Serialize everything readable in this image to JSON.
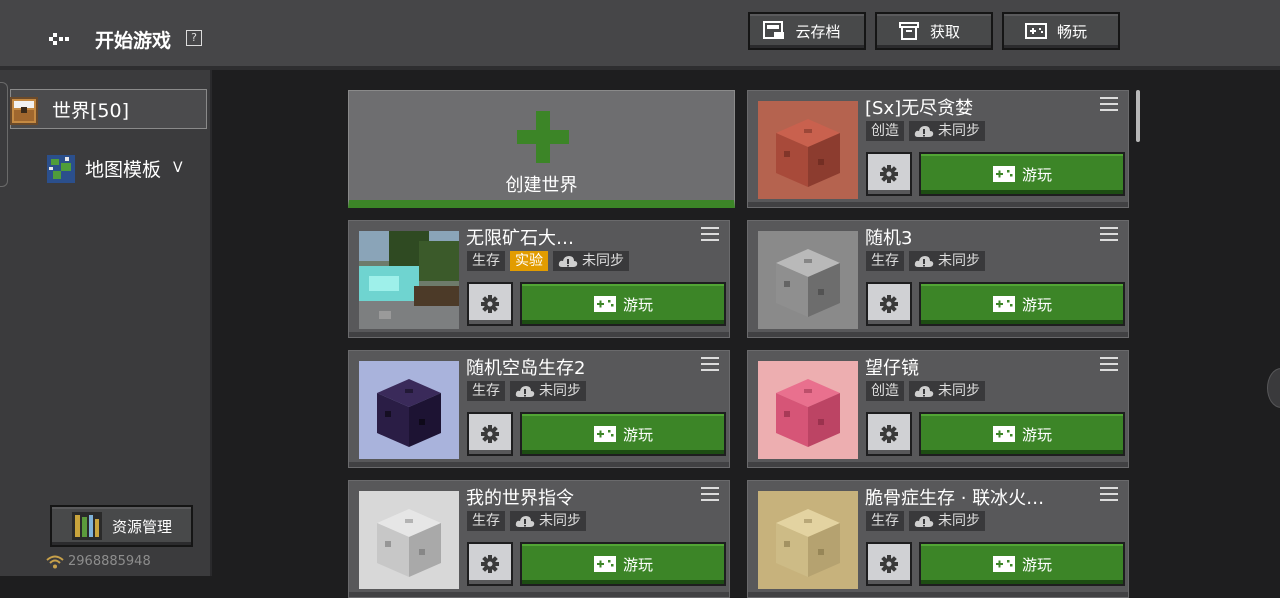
{
  "header": {
    "title": "开始游戏",
    "help_glyph": "?",
    "buttons": [
      {
        "label": "云存档",
        "icon": "cloud-save-icon"
      },
      {
        "label": "获取",
        "icon": "box-icon"
      },
      {
        "label": "畅玩",
        "icon": "gamepad-icon"
      }
    ]
  },
  "sidebar": {
    "items": [
      {
        "label": "世界[50]",
        "icon": "world-chest-icon",
        "selected": true
      },
      {
        "label": "地图模板",
        "icon": "map-globe-icon",
        "chevron": "ᐯ"
      }
    ],
    "resource_button": "资源管理",
    "connection_id": "2968885948"
  },
  "create_card": {
    "label": "创建世界"
  },
  "worlds": [
    {
      "name": "[Sx]无尽贪婪",
      "mode": "创造",
      "experimental": null,
      "sync": "未同步",
      "play": "游玩",
      "thumb": "red-block"
    },
    {
      "name": "无限矿石大…",
      "mode": "生存",
      "experimental": "实验",
      "sync": "未同步",
      "play": "游玩",
      "thumb": "landscape"
    },
    {
      "name": "随机3",
      "mode": "生存",
      "experimental": null,
      "sync": "未同步",
      "play": "游玩",
      "thumb": "gray-block"
    },
    {
      "name": "随机空岛生存2",
      "mode": "生存",
      "experimental": null,
      "sync": "未同步",
      "play": "游玩",
      "thumb": "obsidian-block"
    },
    {
      "name": "望仔镜",
      "mode": "创造",
      "experimental": null,
      "sync": "未同步",
      "play": "游玩",
      "thumb": "pink-block"
    },
    {
      "name": "我的世界指令",
      "mode": "生存",
      "experimental": null,
      "sync": "未同步",
      "play": "游玩",
      "thumb": "white-block"
    },
    {
      "name": "脆骨症生存 · 联冰火…",
      "mode": "生存",
      "experimental": null,
      "sync": "未同步",
      "play": "游玩",
      "thumb": "sand-block"
    }
  ],
  "colors": {
    "accent_green": "#3c8527",
    "experimental": "#e29c00",
    "panel": "#58585a"
  }
}
